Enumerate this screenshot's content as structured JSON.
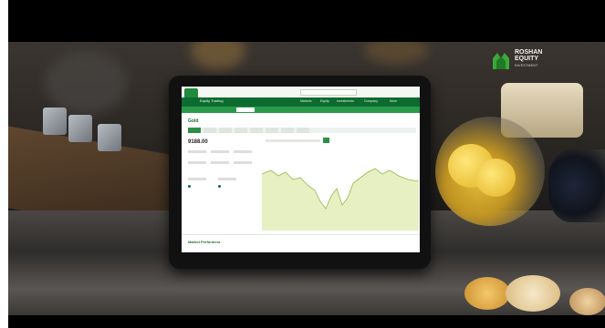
{
  "logo": {
    "line1": "ROSHAN",
    "line2": "EQUITY",
    "line3": "INVESTMENT",
    "accent_color": "#3aa83a"
  },
  "tablet_app": {
    "brand": "Equity Trading",
    "nav_items": [
      "Markets",
      "Equity",
      "Investments",
      "Company",
      "More"
    ],
    "page_title": "Gold",
    "price": "9188.00",
    "footer_title": "Market Performers",
    "accent_color": "#0c6b2f"
  }
}
